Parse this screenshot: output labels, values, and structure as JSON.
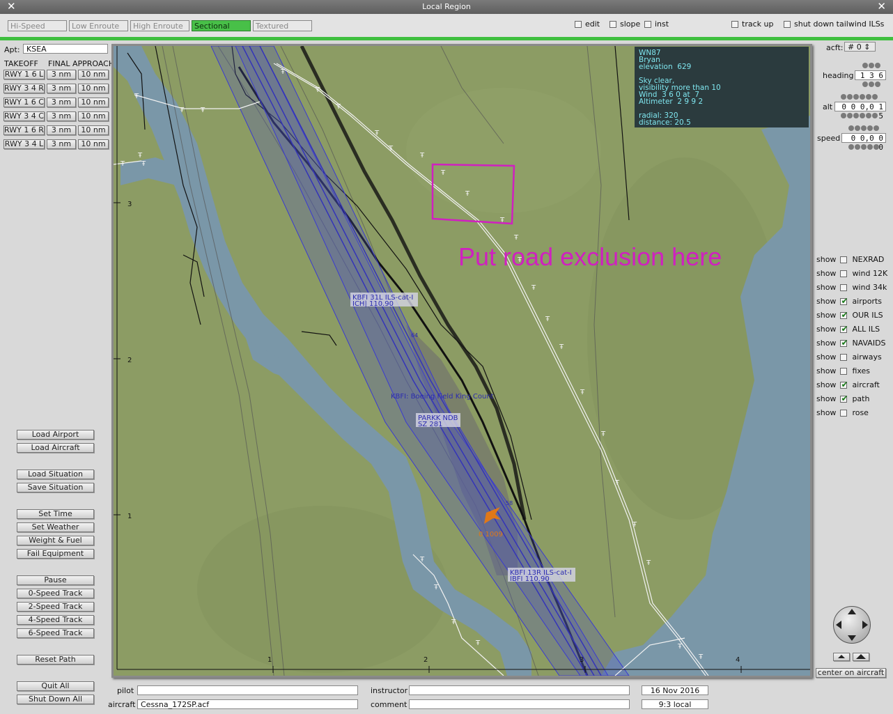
{
  "window": {
    "title": "Local Region",
    "close_left": "✕",
    "close_right": "✕"
  },
  "tabs": [
    {
      "label": "Hi-Speed",
      "active": false
    },
    {
      "label": "Low Enroute",
      "active": false
    },
    {
      "label": "High Enroute",
      "active": false
    },
    {
      "label": "Sectional",
      "active": true
    },
    {
      "label": "Textured",
      "active": false
    }
  ],
  "top_checks": {
    "edit": {
      "label": "edit",
      "checked": false
    },
    "slope": {
      "label": "slope",
      "checked": false
    },
    "inst": {
      "label": "inst",
      "checked": false
    },
    "track_up": {
      "label": "track up",
      "checked": false
    },
    "shut_down": {
      "label": "shut down tailwind ILSs",
      "checked": false
    }
  },
  "left_panel": {
    "apt_label": "Apt:",
    "apt_value": "KSEA",
    "takeoff_header": "TAKEOFF",
    "approach_header": "FINAL APPROACH",
    "runways": [
      {
        "rwy": "RWY 1 6 L",
        "a": "3 nm",
        "b": "10 nm"
      },
      {
        "rwy": "RWY 3 4 R",
        "a": "3 nm",
        "b": "10 nm"
      },
      {
        "rwy": "RWY 1 6 C",
        "a": "3 nm",
        "b": "10 nm"
      },
      {
        "rwy": "RWY 3 4 C",
        "a": "3 nm",
        "b": "10 nm"
      },
      {
        "rwy": "RWY 1 6 R",
        "a": "3 nm",
        "b": "10 nm"
      },
      {
        "rwy": "RWY 3 4 L",
        "a": "3 nm",
        "b": "10 nm"
      }
    ],
    "buttons": {
      "load_airport": "Load Airport",
      "load_aircraft": "Load Aircraft",
      "load_situation": "Load Situation",
      "save_situation": "Save Situation",
      "set_time": "Set Time",
      "set_weather": "Set Weather",
      "weight_fuel": "Weight & Fuel",
      "fail_equipment": "Fail Equipment",
      "pause": "Pause",
      "speed0": "0-Speed Track",
      "speed2": "2-Speed Track",
      "speed4": "4-Speed Track",
      "speed6": "6-Speed Track",
      "reset_path": "Reset Path",
      "quit_all": "Quit All",
      "shut_down_all": "Shut Down All"
    }
  },
  "info": {
    "lines": [
      "WN87",
      "Bryan",
      "elevation  629",
      "",
      "Sky clear,",
      "visibility more than 10",
      "Wind  3 6 0 at  7",
      "Altimeter  2 9 9 2",
      "",
      "radial: 320",
      "distance: 20.5"
    ]
  },
  "map": {
    "annotation": "Put road exclusion here",
    "x_ticks": [
      "1",
      "2",
      "3",
      "4"
    ],
    "y_ticks": [
      "3",
      "2",
      "1"
    ],
    "labels": {
      "kbfi31l_1": "KBFI 31L ILS-cat-I",
      "kbfi31l_2": "ICH|         110.90",
      "kbfi_name": "KBFI: Boeing Field King Count",
      "parkk_1": "PARKK NDB",
      "parkk_2": "SZ          281",
      "kbfi13r_1": "KBFI 13R ILS-cat-I",
      "kbfi13r_2": "IBFI         110.90",
      "aircraft": "0  1009",
      "small_64": "64",
      "small_58": "58"
    }
  },
  "right_panel": {
    "acft_label": "acft:",
    "acft_value": "# 0",
    "heading_label": "heading",
    "heading_value": "1 3 6",
    "alt_label": "alt",
    "alt_value": "0 0 0,0 1 5",
    "speed_label": "speed",
    "speed_value": "0 0,0 0 0",
    "show_word": "show",
    "layers": [
      {
        "label": "NEXRAD",
        "checked": false
      },
      {
        "label": "wind 12K",
        "checked": false
      },
      {
        "label": "wind 34k",
        "checked": false
      },
      {
        "label": "airports",
        "checked": true
      },
      {
        "label": "OUR ILS",
        "checked": true
      },
      {
        "label": "ALL ILS",
        "checked": true
      },
      {
        "label": "NAVAIDS",
        "checked": true
      },
      {
        "label": "airways",
        "checked": false
      },
      {
        "label": "fixes",
        "checked": false
      },
      {
        "label": "aircraft",
        "checked": true
      },
      {
        "label": "path",
        "checked": true
      },
      {
        "label": "rose",
        "checked": false
      }
    ],
    "center_on_aircraft": "center on aircraft"
  },
  "bottom": {
    "pilot_label": "pilot",
    "pilot_value": "",
    "aircraft_label": "aircraft",
    "aircraft_value": "Cessna_172SP.acf",
    "instructor_label": "instructor",
    "instructor_value": "",
    "comment_label": "comment",
    "comment_value": "",
    "date": "16 Nov  2016",
    "time": "9:3 local"
  },
  "colors": {
    "accent_green": "#3fbf3f",
    "map_land": "#8a9b63",
    "water": "#7a97a8",
    "ils": "#3a3ad0",
    "annotation": "#d020c0",
    "info_text": "#7fe6ef"
  }
}
